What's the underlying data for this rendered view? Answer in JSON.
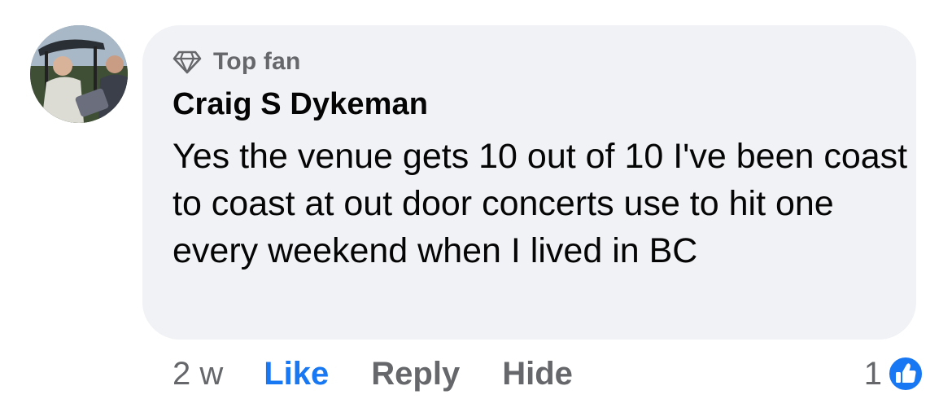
{
  "comment": {
    "badge": "Top fan",
    "author": "Craig S Dykeman",
    "text": "Yes the venue gets 10 out of 10 I've been coast to coast at out door concerts use to hit one every weekend when I lived in BC"
  },
  "actions": {
    "time": "2 w",
    "like": "Like",
    "reply": "Reply",
    "hide": "Hide"
  },
  "reactions": {
    "count": "1",
    "icon": "thumbs-up-icon",
    "color": "#1877f2"
  },
  "colors": {
    "bubble": "#f0f2f5",
    "secondary_text": "#65676b",
    "primary_text": "#050505",
    "accent": "#1877f2"
  }
}
